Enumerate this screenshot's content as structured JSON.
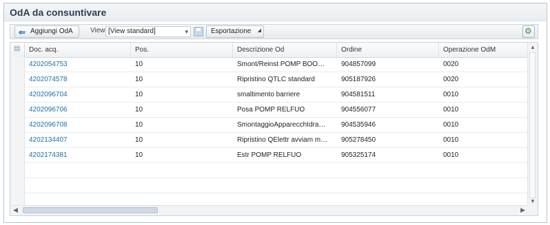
{
  "window": {
    "title": "OdA da consuntivare"
  },
  "toolbar": {
    "add_button": "Aggiungi OdA",
    "view_label": "View:",
    "view_value": "[View standard]",
    "export_button": "Esportazione"
  },
  "table": {
    "columns": [
      "Doc. acq.",
      "Pos.",
      "Descrizione Od",
      "Ordine",
      "Operazione OdM"
    ],
    "rows": [
      [
        "4202054753",
        "10",
        "Smont/Reinst POMP BOO…",
        "904857099",
        "0020"
      ],
      [
        "4202074578",
        "10",
        "Ripristino QTLC standard",
        "905187926",
        "0020"
      ],
      [
        "4202096704",
        "10",
        "smaltimento barriere",
        "904581511",
        "0010"
      ],
      [
        "4202096706",
        "10",
        "Posa POMP RELFUO",
        "904556077",
        "0010"
      ],
      [
        "4202096708",
        "10",
        "SmontaggioApparecchIdra…",
        "904535946",
        "0010"
      ],
      [
        "4202134407",
        "10",
        "Ripristino QElettr avviam m…",
        "905278450",
        "0010"
      ],
      [
        "4202174381",
        "10",
        "Estr POMP RELFUO",
        "905325174",
        "0010"
      ]
    ]
  },
  "icons": {
    "add": "arrow-left-icon",
    "save": "save-icon",
    "settings": "settings-icon"
  },
  "colors": {
    "link": "#1f6fa8",
    "title": "#2c3e50"
  }
}
